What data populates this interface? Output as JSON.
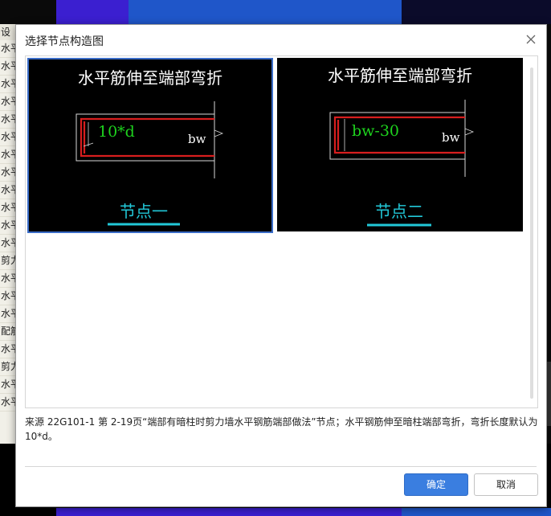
{
  "background": {
    "sidebar_header": "设",
    "sidebar_rows": [
      "水平",
      "水平",
      "水平",
      "水平",
      "水平",
      "水平",
      "水平",
      "水平",
      "水平",
      "水平",
      "水平",
      "水平",
      "剪力",
      "水平",
      "水平",
      "水平",
      "配筋",
      "水平",
      "剪力",
      "水平",
      "水平"
    ]
  },
  "dialog": {
    "title": "选择节点构造图",
    "close_icon": "close-icon",
    "options": [
      {
        "heading": "水平筋伸至端部弯折",
        "dim_label": "10*d",
        "bw_label": "bw",
        "node_label": "节点一",
        "selected": true
      },
      {
        "heading": "水平筋伸至端部弯折",
        "dim_label": "bw-30",
        "bw_label": "bw",
        "node_label": "节点二",
        "selected": false
      }
    ],
    "description": "来源 22G101-1 第 2-19页“端部有暗柱时剪力墙水平钢筋端部做法”节点；水平钢筋伸至暗柱端部弯折，弯折长度默认为 10*d。",
    "ok_label": "确定",
    "cancel_label": "取消"
  },
  "colors": {
    "selection_border": "#3a6cc7",
    "heading_text": "#ffffff",
    "dim_text": "#1ed21e",
    "node_text": "#22c8d8",
    "rebar": "#d81e1e",
    "ok_button": "#3a7ee0"
  }
}
